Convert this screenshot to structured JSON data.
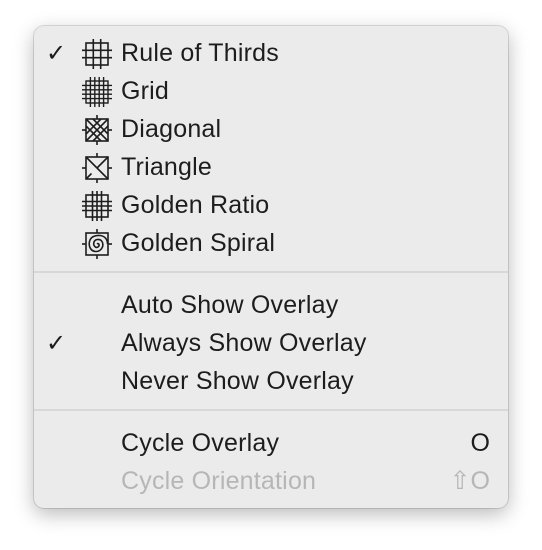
{
  "menu": {
    "overlays": [
      {
        "label": "Rule of Thirds",
        "icon": "rule-of-thirds-icon",
        "checked": true
      },
      {
        "label": "Grid",
        "icon": "grid-icon",
        "checked": false
      },
      {
        "label": "Diagonal",
        "icon": "diagonal-icon",
        "checked": false
      },
      {
        "label": "Triangle",
        "icon": "triangle-icon",
        "checked": false
      },
      {
        "label": "Golden Ratio",
        "icon": "golden-ratio-icon",
        "checked": false
      },
      {
        "label": "Golden Spiral",
        "icon": "golden-spiral-icon",
        "checked": false
      }
    ],
    "show_modes": [
      {
        "label": "Auto Show Overlay",
        "checked": false
      },
      {
        "label": "Always Show Overlay",
        "checked": true
      },
      {
        "label": "Never Show Overlay",
        "checked": false
      }
    ],
    "actions": [
      {
        "label": "Cycle Overlay",
        "shortcut": "O",
        "enabled": true
      },
      {
        "label": "Cycle Orientation",
        "shortcut": "⇧O",
        "enabled": false
      }
    ],
    "check_glyph": "✓"
  },
  "colors": {
    "menu_background": "#ebebeb",
    "text": "#1d1d1d",
    "disabled_text": "#b6b6b6",
    "separator": "#d8d8d8"
  }
}
